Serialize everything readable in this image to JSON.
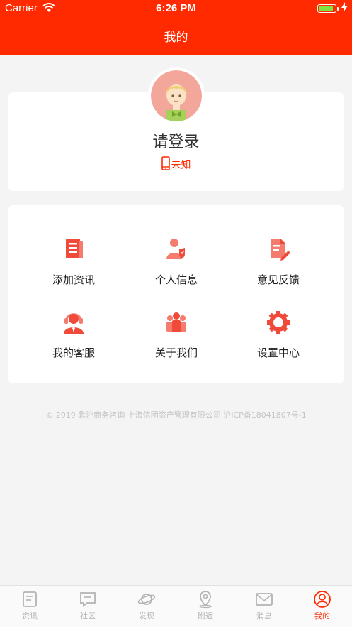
{
  "status_bar": {
    "carrier": "Carrier",
    "time": "6:26 PM"
  },
  "nav": {
    "title": "我的"
  },
  "profile": {
    "login_text": "请登录",
    "phone_status": "未知"
  },
  "menu": {
    "items": [
      {
        "label": "添加资讯",
        "icon": "document-icon"
      },
      {
        "label": "个人信息",
        "icon": "user-shield-icon"
      },
      {
        "label": "意见反馈",
        "icon": "feedback-edit-icon"
      },
      {
        "label": "我的客服",
        "icon": "customer-service-icon"
      },
      {
        "label": "关于我们",
        "icon": "team-icon"
      },
      {
        "label": "设置中心",
        "icon": "settings-gear-icon"
      }
    ]
  },
  "footer": {
    "copyright": "© 2019 犇沪商务咨询 上海信团资产管理有限公司 沪ICP备18041807号-1"
  },
  "tabbar": {
    "tabs": [
      {
        "label": "资讯",
        "icon": "news-icon",
        "active": false
      },
      {
        "label": "社区",
        "icon": "community-icon",
        "active": false
      },
      {
        "label": "发现",
        "icon": "planet-icon",
        "active": false
      },
      {
        "label": "附近",
        "icon": "location-icon",
        "active": false
      },
      {
        "label": "消息",
        "icon": "mail-icon",
        "active": false
      },
      {
        "label": "我的",
        "icon": "profile-icon",
        "active": true
      }
    ]
  },
  "colors": {
    "accent": "#ff2a00",
    "icon_red": "#f04a3a",
    "background": "#f4f4f4",
    "tab_inactive": "#b3b3b3"
  }
}
